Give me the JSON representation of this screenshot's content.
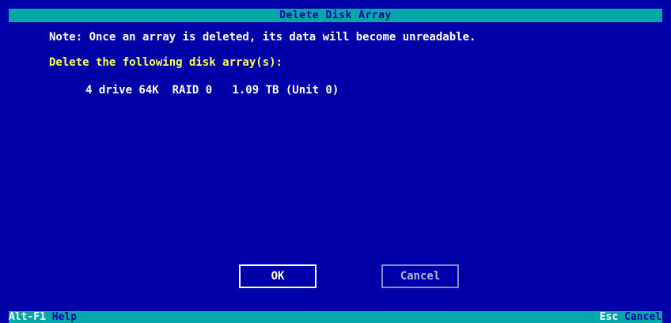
{
  "window": {
    "title": "Delete Disk Array"
  },
  "dialog": {
    "note": "Note: Once an array is deleted, its data will become unreadable.",
    "prompt": "Delete the following disk array(s):",
    "arrays": [
      "4 drive 64K  RAID 0   1.09 TB (Unit 0)"
    ]
  },
  "buttons": {
    "ok_label": "OK",
    "cancel_label": "Cancel"
  },
  "statusbar": {
    "help_key": "Alt-F1",
    "help_label": "Help",
    "cancel_key": "Esc",
    "cancel_label": "Cancel"
  },
  "colors": {
    "background": "#0000a8",
    "bar": "#00a8a8",
    "text": "#ffffff",
    "highlight": "#ffff55"
  }
}
